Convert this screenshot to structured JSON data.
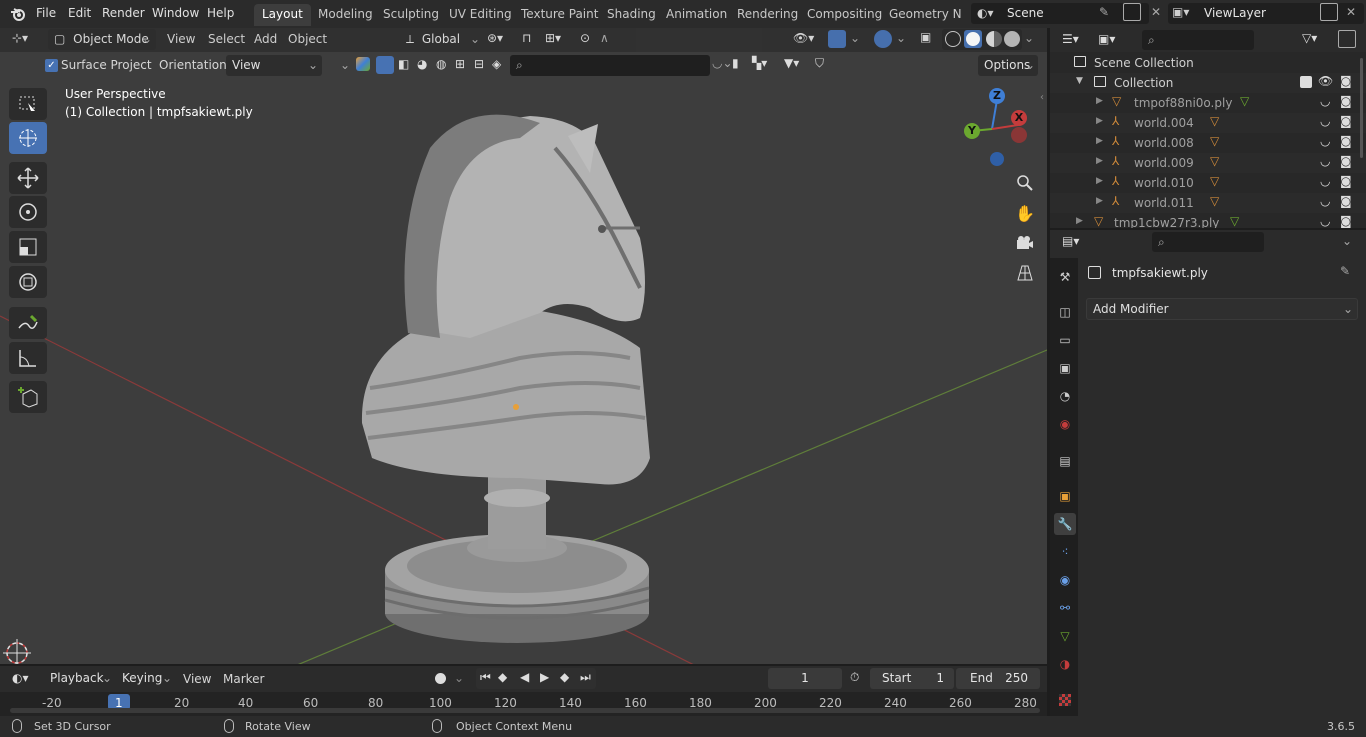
{
  "topbar": {
    "menus": [
      "File",
      "Edit",
      "Render",
      "Window",
      "Help"
    ],
    "workspaces": [
      "Layout",
      "Modeling",
      "Sculpting",
      "UV Editing",
      "Texture Paint",
      "Shading",
      "Animation",
      "Rendering",
      "Compositing",
      "Geometry Noc"
    ],
    "active_workspace": "Layout",
    "scene_name": "Scene",
    "view_layer": "ViewLayer"
  },
  "viewport_header": {
    "mode": "Object Mode",
    "menus": [
      "View",
      "Select",
      "Add",
      "Object"
    ],
    "transform_orientation": "Global"
  },
  "tool_header": {
    "surface_project_label": "Surface Project",
    "surface_project_checked": true,
    "orientation_label": "Orientation:",
    "orientation_value": "View",
    "options_label": "Options"
  },
  "viewport_overlay": {
    "perspective": "User Perspective",
    "collection_info": "(1) Collection | tmpfsakiewt.ply"
  },
  "gizmo": {
    "z": "Z",
    "y": "Y",
    "x": "X"
  },
  "outliner": {
    "root": "Scene Collection",
    "collection": "Collection",
    "items": [
      "tmpof88ni0o.ply",
      "world.004",
      "world.008",
      "world.009",
      "world.010",
      "world.011",
      "tmp1cbw27r3.ply"
    ]
  },
  "properties": {
    "object_name": "tmpfsakiewt.ply",
    "add_modifier": "Add Modifier"
  },
  "timeline": {
    "menus": [
      "Playback",
      "Keying",
      "View",
      "Marker"
    ],
    "current_frame": "1",
    "start_label": "Start",
    "start_value": "1",
    "end_label": "End",
    "end_value": "250",
    "ticks": [
      "-20",
      "1",
      "20",
      "40",
      "60",
      "80",
      "100",
      "120",
      "140",
      "160",
      "180",
      "200",
      "220",
      "240",
      "260",
      "280"
    ]
  },
  "statusbar": {
    "hint1": "Set 3D Cursor",
    "hint2": "Rotate View",
    "hint3": "Object Context Menu",
    "version": "3.6.5"
  },
  "colors": {
    "accent": "#4772b3",
    "x_axis": "#c43c3c",
    "y_axis": "#6ba82f",
    "z_axis": "#3f7fd6",
    "object_orange": "#e8a038"
  }
}
